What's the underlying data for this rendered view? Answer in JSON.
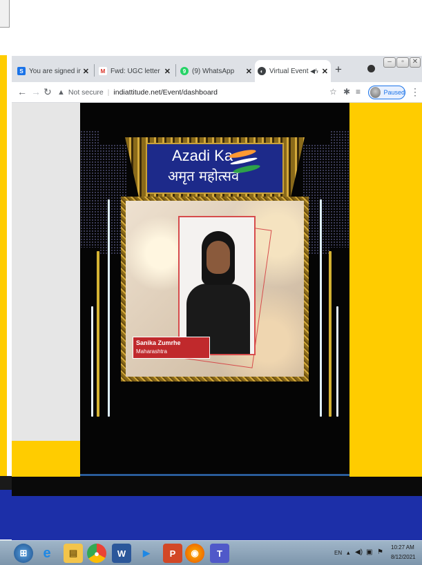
{
  "browser": {
    "tabs": [
      {
        "label": "You are signed in as coe",
        "favicon": "S",
        "favicon_color": "#1a73e8",
        "active": false
      },
      {
        "label": "Fwd: UGC letter regarding",
        "favicon": "M",
        "favicon_color": "#d93025",
        "active": false
      },
      {
        "label": "(9) WhatsApp",
        "favicon": "9",
        "favicon_color": "#25d366",
        "active": false
      },
      {
        "label": "Virtual Event Landing",
        "favicon": "globe",
        "favicon_color": "#3c4043",
        "active": true
      }
    ],
    "address": {
      "security_label": "Not secure",
      "url": "indiattitude.net/Event/dashboard"
    },
    "profile_label": "Paused"
  },
  "event": {
    "banner_line1": "Azadi Ka",
    "banner_line2": "अमृत महोत्सव",
    "speaker_name": "Sanika Zumrhe",
    "speaker_state": "Maharashtra"
  },
  "taskbar": {
    "language": "EN",
    "time": "10:27 AM",
    "date": "8/12/2021"
  },
  "colors": {
    "accent_yellow": "#ffcc00",
    "stage_black": "#050505",
    "footer_blue": "#1c2fa8",
    "nameplate_red": "#c0292c"
  }
}
